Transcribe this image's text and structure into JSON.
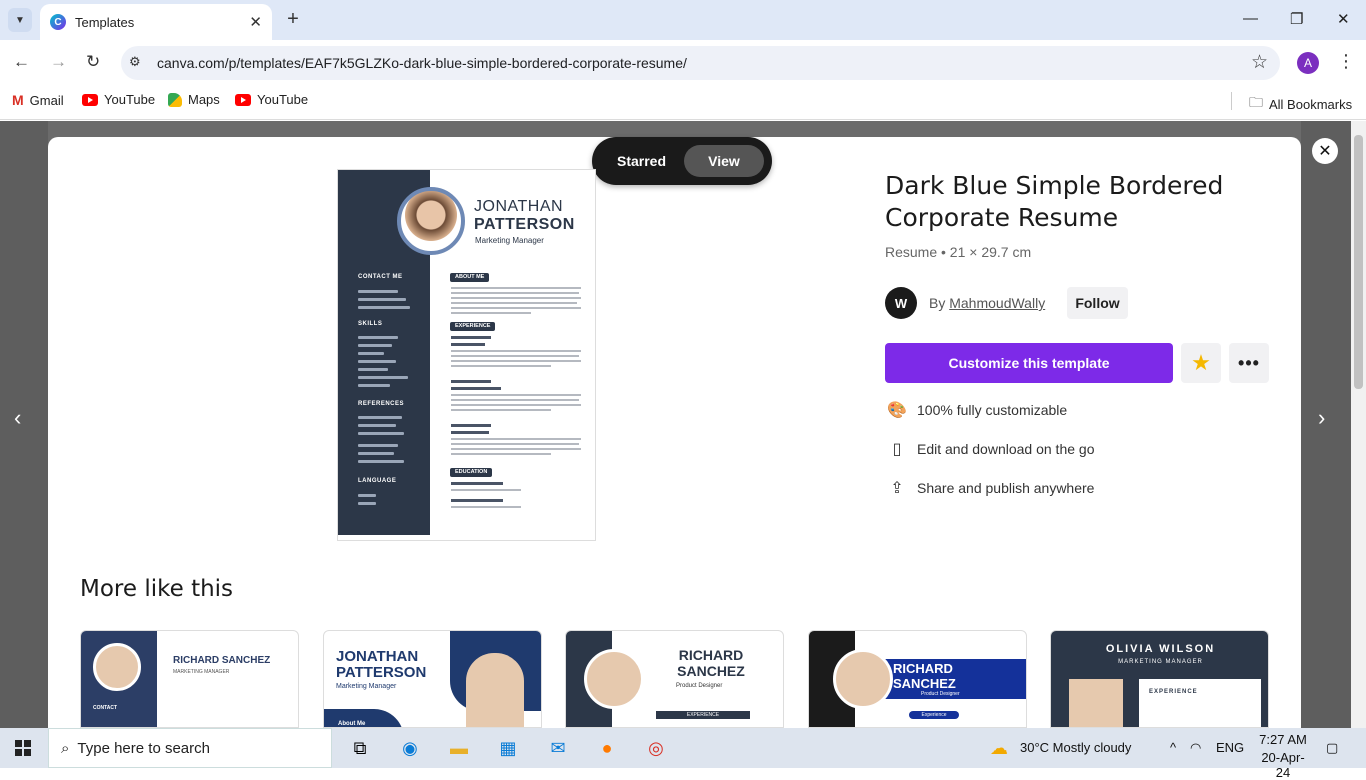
{
  "browser": {
    "tab_title": "Templates",
    "url": "canva.com/p/templates/EAF7k5GLZKo-dark-blue-simple-bordered-corporate-resume/",
    "profile_initial": "A",
    "bookmarks": [
      {
        "label": "Gmail",
        "icon": "gmail-icon"
      },
      {
        "label": "YouTube",
        "icon": "youtube-icon"
      },
      {
        "label": "Maps",
        "icon": "maps-icon"
      },
      {
        "label": "YouTube",
        "icon": "youtube-icon"
      }
    ],
    "all_bookmarks": "All Bookmarks"
  },
  "modal": {
    "toggle": {
      "starred": "Starred",
      "view": "View"
    },
    "title": "Dark Blue Simple Bordered Corporate Resume",
    "subtitle": "Resume • 21 × 29.7 cm",
    "author_initials": "W",
    "author_prefix": "By",
    "author_name": "MahmoudWally",
    "follow": "Follow",
    "cta": "Customize this template",
    "features": [
      {
        "icon": "palette-icon",
        "text": "100% fully customizable"
      },
      {
        "icon": "phone-icon",
        "text": "Edit and download on the go"
      },
      {
        "icon": "share-icon",
        "text": "Share and publish anywhere"
      }
    ],
    "more_title": "More like this"
  },
  "resume": {
    "first_name": "JONATHAN",
    "last_name": "PATTERSON",
    "role": "Marketing Manager",
    "sections_left": [
      "CONTACT ME",
      "SKILLS",
      "REFERENCES",
      "LANGUAGE"
    ],
    "sections_right": [
      "ABOUT ME",
      "EXPERIENCE",
      "EDUCATION"
    ]
  },
  "thumbnails": [
    {
      "name": "RICHARD SANCHEZ",
      "role": "MARKETING MANAGER",
      "tag": "CONTACT",
      "accent": "#2c3e66"
    },
    {
      "name": "JONATHAN PATTERSON",
      "role": "Marketing Manager",
      "tag": "About Me",
      "accent": "#1f3a6e"
    },
    {
      "name": "RICHARD SANCHEZ",
      "role": "Product Designer",
      "tag": "EXPERIENCE",
      "accent": "#2c3748"
    },
    {
      "name": "RICHARD SANCHEZ",
      "role": "Product Designer",
      "tag": "Experience",
      "accent": "#14319a"
    },
    {
      "name": "OLIVIA WILSON",
      "role": "MARKETING MANAGER",
      "tag": "EXPERIENCE",
      "accent": "#2c3748"
    }
  ],
  "taskbar": {
    "search_placeholder": "Type here to search",
    "weather": "30°C  Mostly cloudy",
    "language": "ENG",
    "time": "7:27 AM",
    "date": "20-Apr-24"
  },
  "colors": {
    "accent": "#7d2ae8",
    "resume_navy": "#2c3748"
  }
}
